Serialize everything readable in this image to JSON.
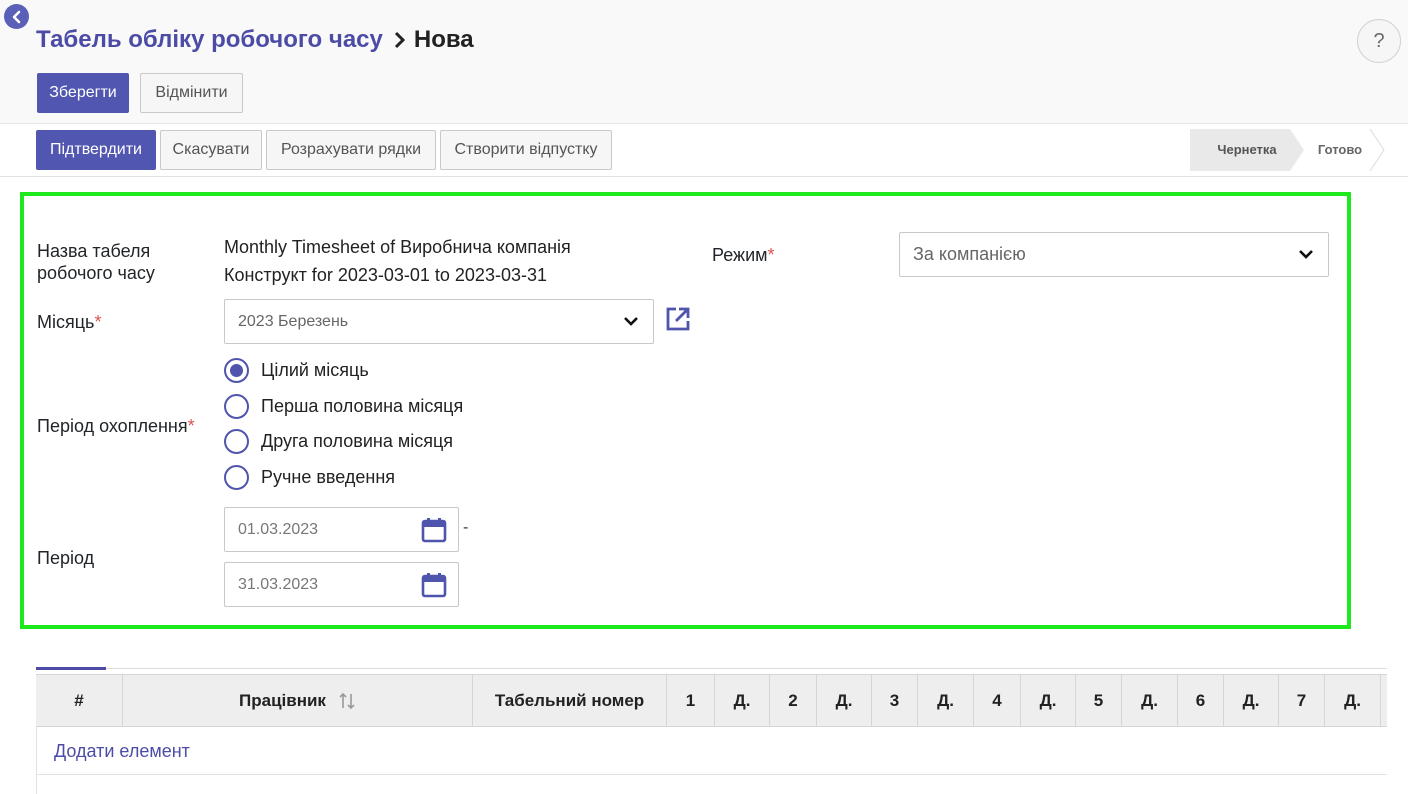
{
  "header": {
    "breadcrumb_parent": "Табель обліку робочого часу",
    "breadcrumb_current": "Нова",
    "help_label": "?"
  },
  "toolbar": {
    "save_label": "Зберегти",
    "discard_label": "Відмінити"
  },
  "actions": {
    "confirm_label": "Підтвердити",
    "cancel_label": "Скасувати",
    "compute_label": "Розрахувати рядки",
    "leave_label": "Створити відпустку"
  },
  "status": {
    "steps": [
      "Чернетка",
      "Готово"
    ],
    "active": "Чернетка"
  },
  "form": {
    "name_label_line1": "Назва табеля",
    "name_label_line2": "робочого часу",
    "name_value_line1": "Monthly Timesheet of Виробнича компанія",
    "name_value_line2": "Конструкт for 2023-03-01 to 2023-03-31",
    "mode_label": "Режим",
    "mode_value": "За компанією",
    "month_label": "Місяць",
    "month_value": "2023 Березень",
    "coverage_label": "Період охоплення",
    "coverage_options": [
      "Цілий місяць",
      "Перша половина місяця",
      "Друга половина місяця",
      "Ручне введення"
    ],
    "coverage_selected": "Цілий місяць",
    "period_label": "Період",
    "period_from": "01.03.2023",
    "period_to": "31.03.2023",
    "period_separator": "-",
    "required_mark": "*"
  },
  "table": {
    "columns": [
      "#",
      "Працівник",
      "Табельний номер",
      "1",
      "Д.",
      "2",
      "Д.",
      "3",
      "Д.",
      "4",
      "Д.",
      "5",
      "Д.",
      "6",
      "Д.",
      "7",
      "Д."
    ],
    "add_item_label": "Додати елемент"
  },
  "colors": {
    "accent": "#5157b0",
    "link": "#4c4ca7",
    "highlight_border": "#1de91d",
    "required": "#d9534f"
  }
}
